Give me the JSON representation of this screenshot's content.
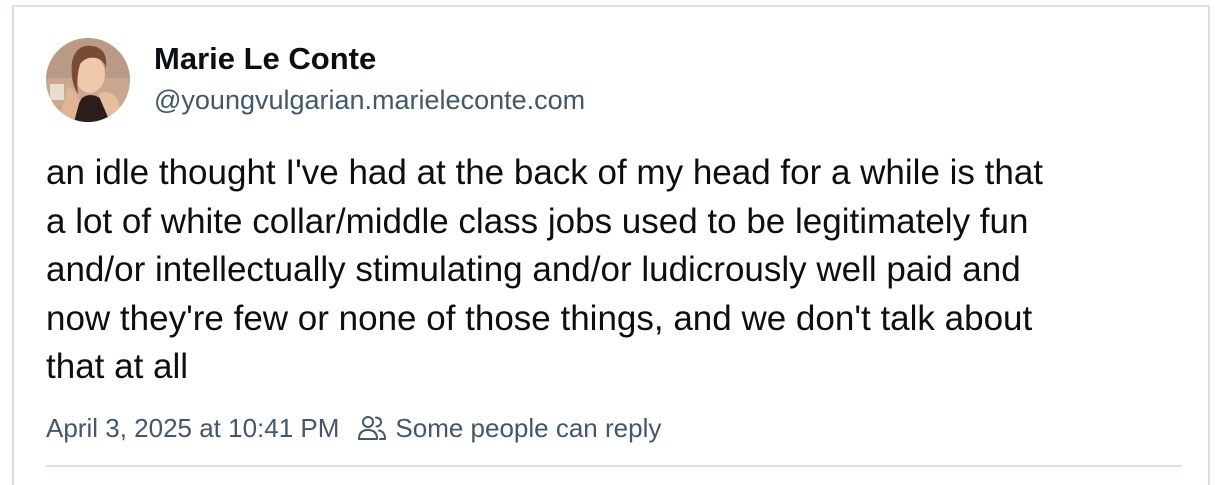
{
  "author": {
    "display_name": "Marie Le Conte",
    "handle": "@youngvulgarian.marieleconte.com",
    "avatar": "profile-photo"
  },
  "post": {
    "text": "an idle thought I've had at the back of my head for a while is that\na lot of white collar/middle class jobs used to be legitimately fun\nand/or intellectually stimulating and/or ludicrously well paid and\nnow they're few or none of those things, and we don't talk about\nthat at all"
  },
  "meta": {
    "timestamp": "April 3, 2025 at 10:41 PM",
    "reply_icon": "people-icon",
    "reply_setting": "Some people can reply"
  },
  "colors": {
    "text": "#0b0f14",
    "secondary_text": "#42576c",
    "border": "#d9e0e8"
  }
}
